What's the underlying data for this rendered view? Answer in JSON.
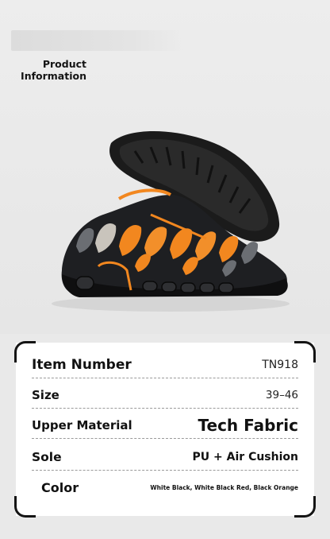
{
  "header": {
    "line1": "Product",
    "line2": "Information"
  },
  "product_image": {
    "description_icon": "sneaker-icon",
    "accent_color": "#f2871f",
    "base_color": "#151515"
  },
  "specs": {
    "item_number": {
      "label": "Item Number",
      "value": "TN918"
    },
    "size": {
      "label": "Size",
      "value": "39–46"
    },
    "upper_material": {
      "label": "Upper Material",
      "value": "Tech Fabric"
    },
    "sole": {
      "label": "Sole",
      "value": "PU + Air Cushion"
    },
    "color": {
      "label": "Color",
      "value": "White Black, White Black Red, Black Orange"
    }
  }
}
